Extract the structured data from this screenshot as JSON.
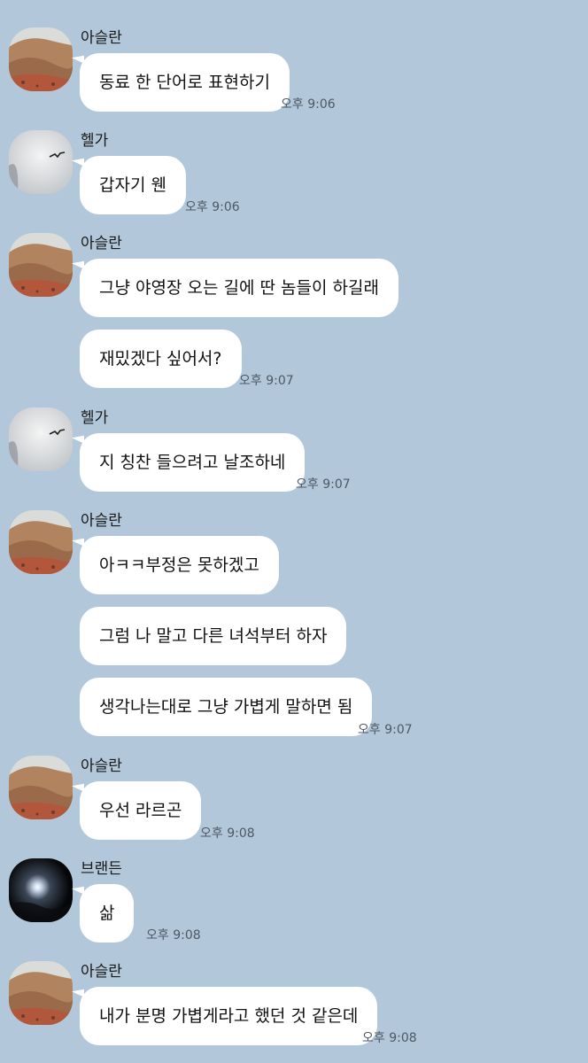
{
  "colors": {
    "background": "#b2c7d9",
    "bubble": "#ffffff",
    "text": "#111111",
    "time": "#4d5966"
  },
  "messages": [
    {
      "sender": "아슬란",
      "avatar": "desert-avatar",
      "text": "동료 한 단어로 표현하기",
      "time": "오후 9:06"
    },
    {
      "sender": "헬가",
      "avatar": "sky-bird-avatar",
      "text": "갑자기 웬",
      "time": "오후 9:06"
    },
    {
      "sender": "아슬란",
      "avatar": "desert-avatar",
      "text": "그냥 야영장 오는 길에 딴 놈들이 하길래"
    },
    {
      "text": "재밌겠다 싶어서?",
      "time": "오후 9:07"
    },
    {
      "sender": "헬가",
      "avatar": "sky-bird-avatar",
      "text": "지 칭찬 들으려고 날조하네",
      "time": "오후 9:07"
    },
    {
      "sender": "아슬란",
      "avatar": "desert-avatar",
      "text": "아ㅋㅋ부정은 못하겠고"
    },
    {
      "text": "그럼 나 말고 다른 녀석부터 하자"
    },
    {
      "text": "생각나는대로 그냥 가볍게 말하면 됨",
      "time": "오후 9:07"
    },
    {
      "sender": "아슬란",
      "avatar": "desert-avatar",
      "text": "우선 라르곤",
      "time": "오후 9:08"
    },
    {
      "sender": "브랜든",
      "avatar": "night-moon-avatar",
      "text": "삶",
      "time": "오후 9:08"
    },
    {
      "sender": "아슬란",
      "avatar": "desert-avatar",
      "text": "내가 분명 가볍게라고 했던 것 같은데",
      "time": "오후 9:08"
    }
  ]
}
